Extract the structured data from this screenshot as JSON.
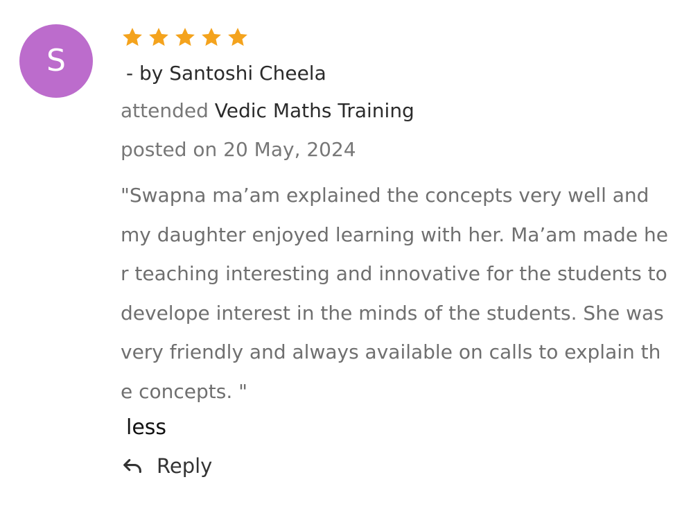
{
  "avatar": {
    "initial": "S",
    "color": "#bc6ccc"
  },
  "rating": {
    "stars": 5,
    "max": 5,
    "color": "#f4a31d"
  },
  "author_line": " - by Santoshi Cheela",
  "attended": {
    "prefix": "attended ",
    "course": "Vedic Maths Training"
  },
  "posted": "posted on 20 May, 2024",
  "review_text": "\"Swapna ma’am explained the concepts very well and my daughter enjoyed learning with her. Ma’am made her teaching interesting and innovative for the students to develope interest in the minds of the students. She was very friendly and always available on calls to explain the concepts. \"",
  "less_label": "less",
  "reply": {
    "label": "Reply",
    "icon": "reply-arrow-icon"
  }
}
